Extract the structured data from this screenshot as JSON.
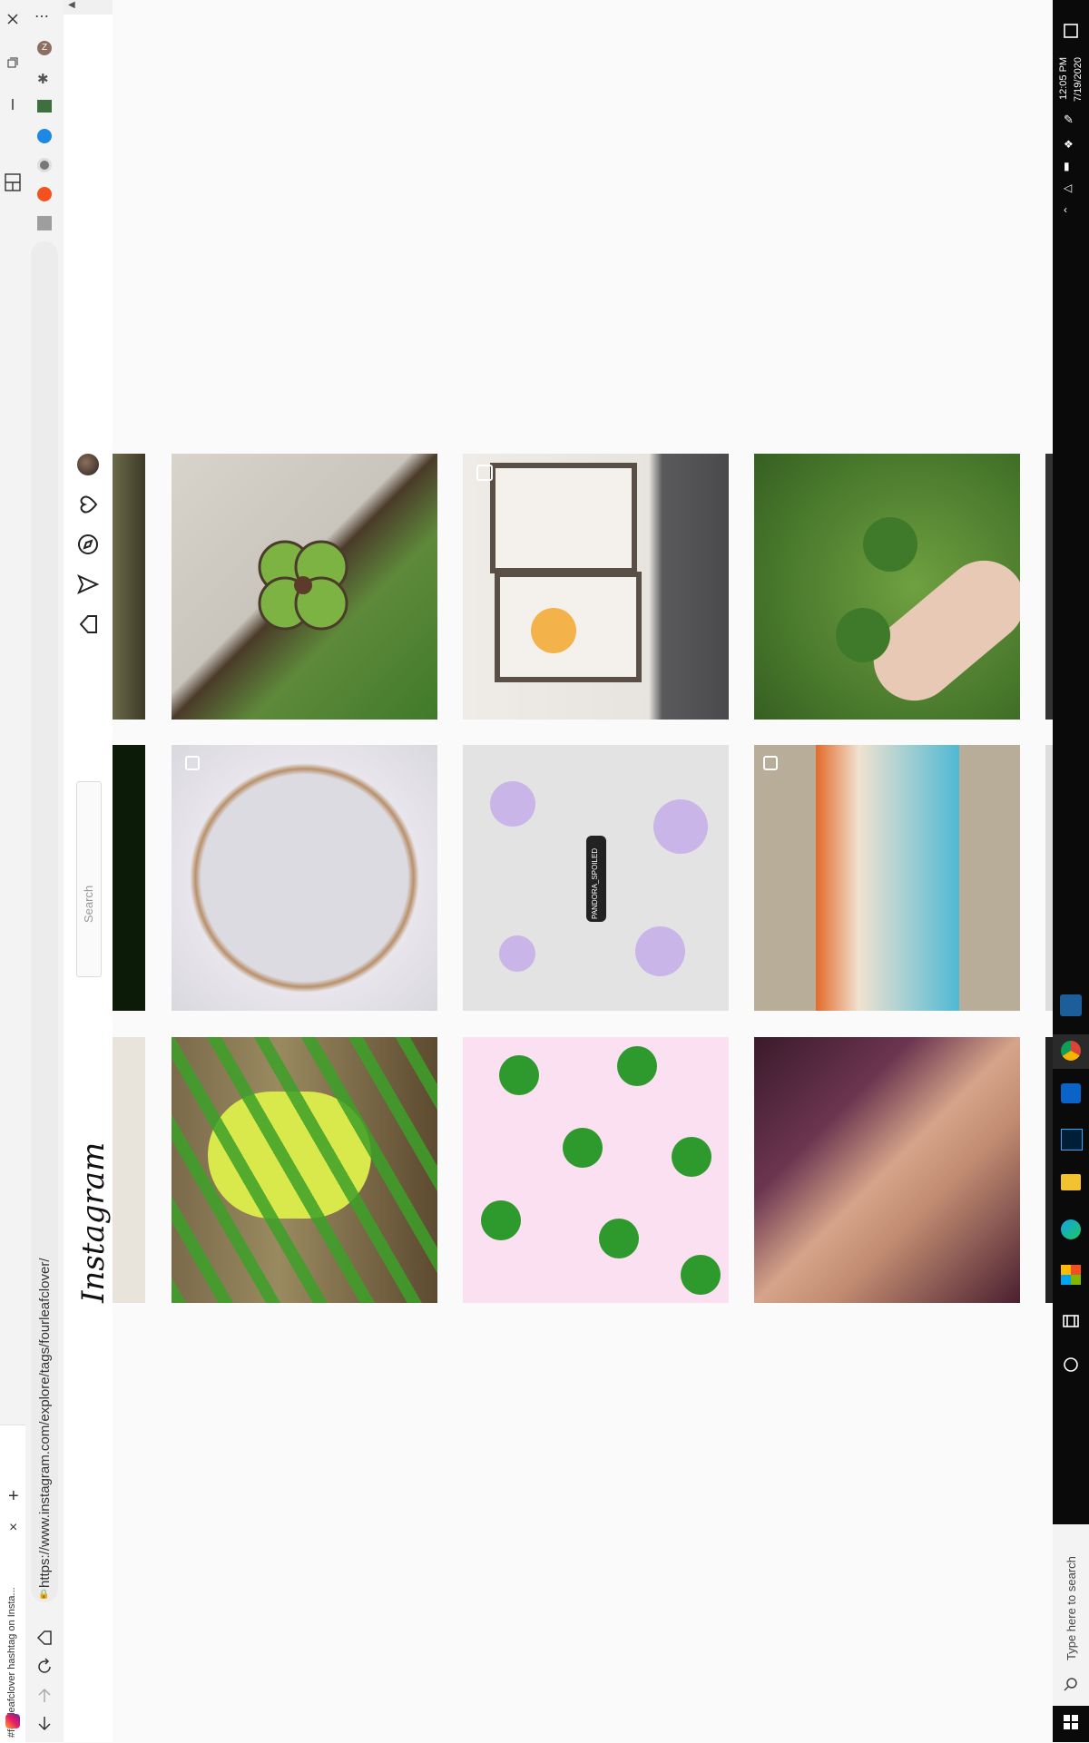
{
  "browser": {
    "tab_title": "#fourleafclover hashtag on Insta...",
    "url": "https://www.instagram.com/explore/tags/fourleafclover/",
    "new_tab": "+",
    "tab_close": "×"
  },
  "instagram": {
    "logo": "Instagram",
    "search_placeholder": "Search",
    "nav_icons": [
      "home-icon",
      "direct-icon",
      "explore-icon",
      "activity-icon",
      "profile-avatar"
    ]
  },
  "posts": [
    {
      "row": 1,
      "desc": "clover-plant-photo"
    },
    {
      "row": 1,
      "desc": "framed-art-photo",
      "multi": true
    },
    {
      "row": 1,
      "desc": "hand-holding-clovers"
    },
    {
      "row": 2,
      "desc": "ceramic-plate",
      "multi": true
    },
    {
      "row": 2,
      "desc": "pandora-spoiled-graphic",
      "text": "PANDORA_SPOILED"
    },
    {
      "row": 2,
      "desc": "group-tag-photo",
      "multi": true
    },
    {
      "row": 3,
      "desc": "man-in-plants"
    },
    {
      "row": 3,
      "desc": "clover-pattern"
    },
    {
      "row": 3,
      "desc": "woman-portrait"
    }
  ],
  "taskbar": {
    "search": "Type here to search",
    "time": "12:05 PM",
    "date": "7/19/2020"
  },
  "colors": {
    "taskbar_bg": "#0a0a0a",
    "page_bg": "#fafafa",
    "instagram_accent": "#c13584"
  }
}
